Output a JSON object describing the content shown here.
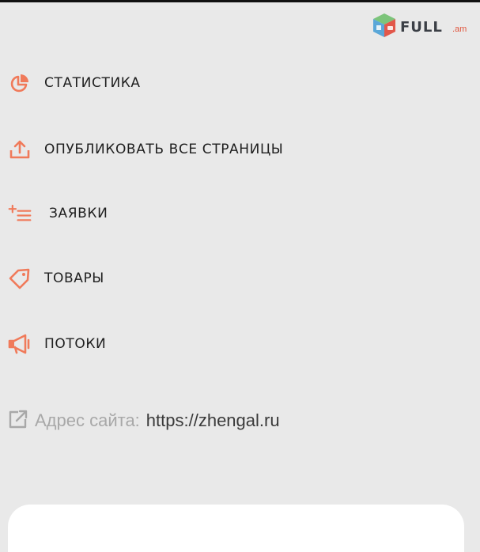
{
  "logo": {
    "text": "FULL",
    "domain": ".am"
  },
  "menu": {
    "items": [
      {
        "id": "statistics",
        "label": "СТАТИСТИКА",
        "icon": "pie-chart-icon"
      },
      {
        "id": "publish",
        "label": "ОПУБЛИКОВАТЬ ВСЕ СТРАНИЦЫ",
        "icon": "upload-icon"
      },
      {
        "id": "orders",
        "label": "ЗАЯВКИ",
        "icon": "add-list-icon"
      },
      {
        "id": "products",
        "label": "ТОВАРЫ",
        "icon": "tag-icon"
      },
      {
        "id": "streams",
        "label": "ПОТОКИ",
        "icon": "megaphone-icon"
      }
    ]
  },
  "site": {
    "label": "Адрес сайта:",
    "url": "https://zhengal.ru",
    "icon": "external-link-icon"
  },
  "colors": {
    "accent": "#f07a5a",
    "background": "#e9e9e9",
    "text": "#1f1f1f"
  }
}
